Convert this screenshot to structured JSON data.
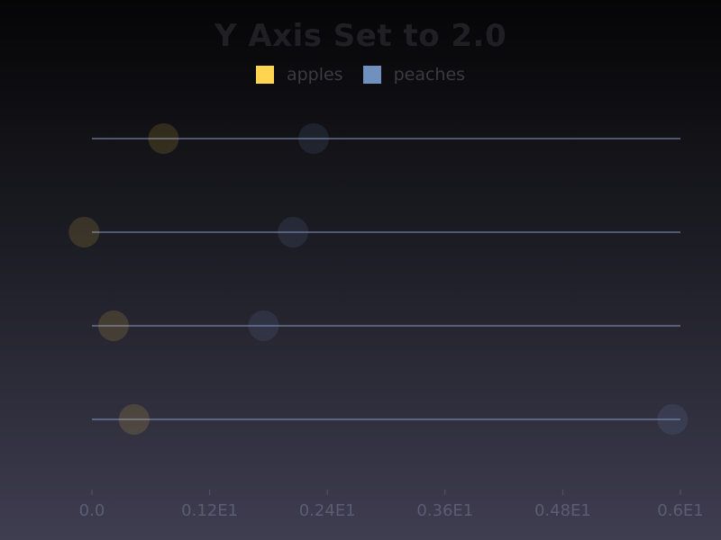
{
  "chart_data": {
    "type": "scatter",
    "title": "Y Axis Set to 2.0",
    "xlabel": "",
    "ylabel": "",
    "xlim": [
      0,
      6
    ],
    "x_ticks": [
      "0.0",
      "0.12E1",
      "0.24E1",
      "0.36E1",
      "0.48E1",
      "0.6E1"
    ],
    "y_rows": 4,
    "grid": true,
    "legend_placement": "top-center",
    "series": [
      {
        "name": "apples",
        "color": "#ffd54f",
        "points": [
          {
            "row": 1,
            "x": 0.73
          },
          {
            "row": 2,
            "x": -0.08
          },
          {
            "row": 3,
            "x": 0.22
          },
          {
            "row": 4,
            "x": 0.43
          }
        ]
      },
      {
        "name": "peaches",
        "color": "#7090c0",
        "points": [
          {
            "row": 1,
            "x": 2.26
          },
          {
            "row": 2,
            "x": 2.05
          },
          {
            "row": 3,
            "x": 1.75
          },
          {
            "row": 4,
            "x": 5.92
          }
        ]
      }
    ]
  },
  "colors": {
    "gridline": "#8a9ac8",
    "tick": "#55556a",
    "tick_label": "#5c5c72"
  }
}
